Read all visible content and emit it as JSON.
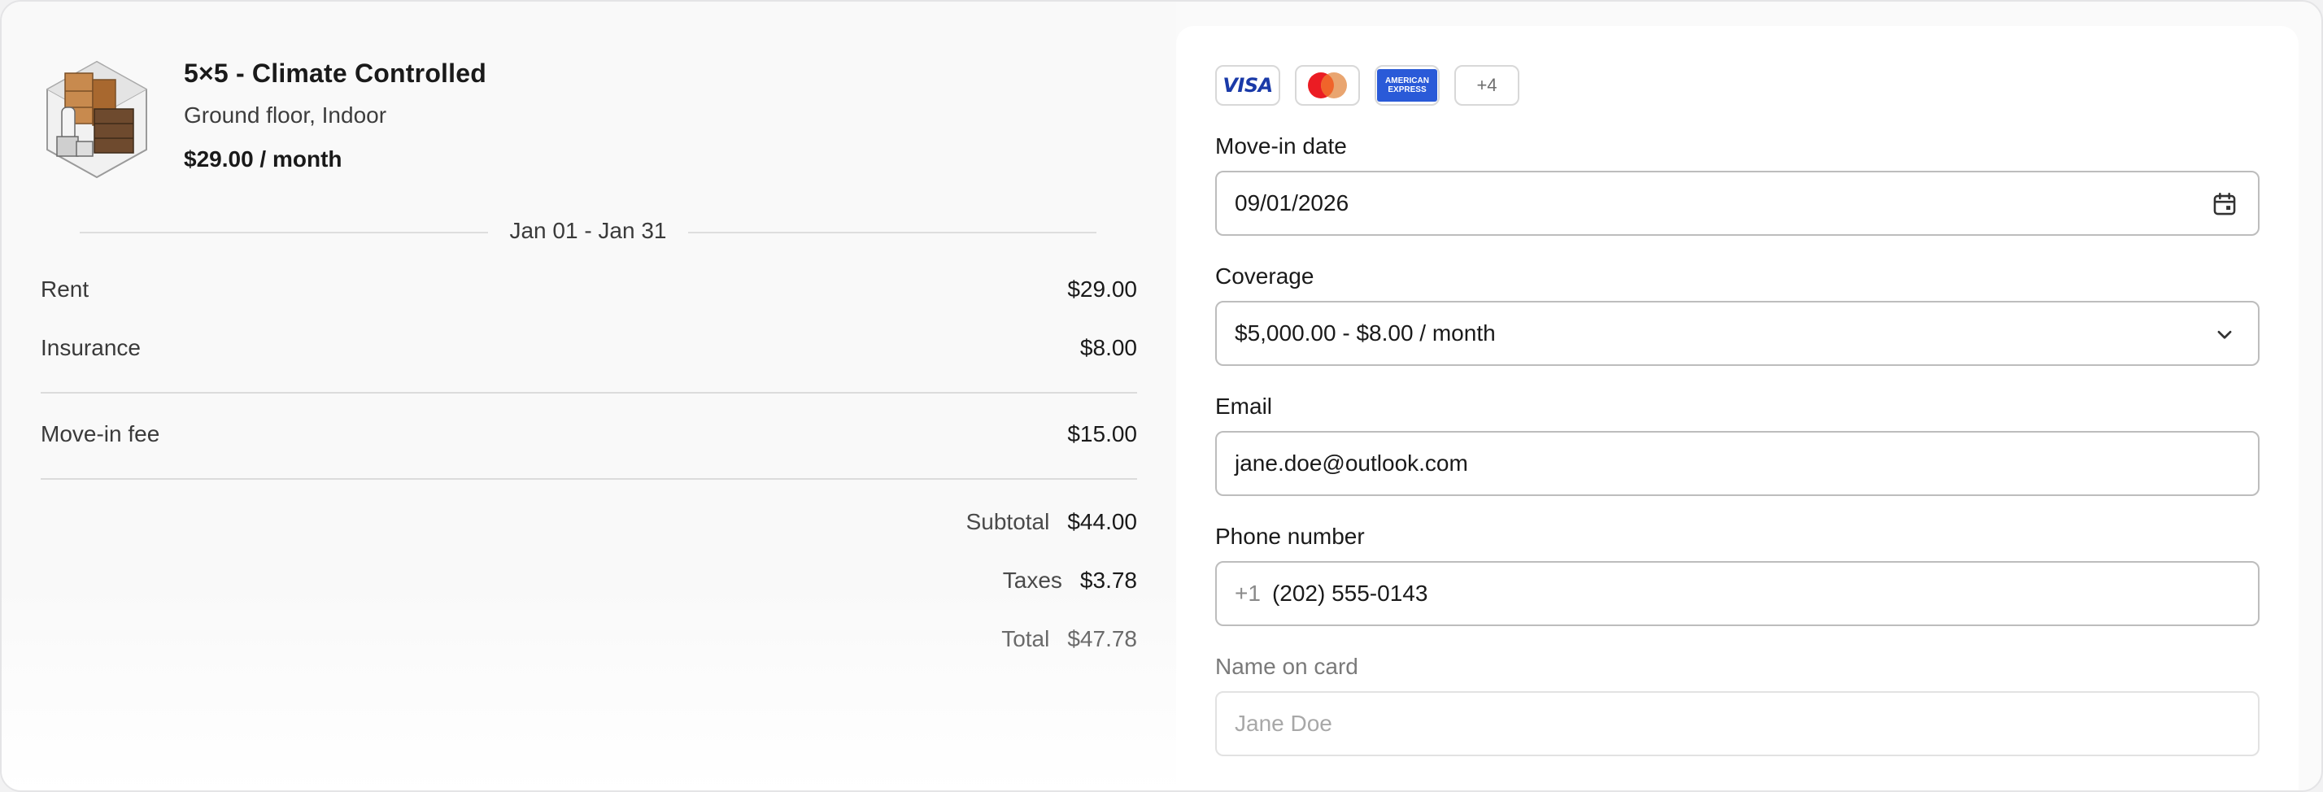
{
  "unit": {
    "title": "5×5 - Climate Controlled",
    "subtitle": "Ground floor, Indoor",
    "price": "$29.00 / month"
  },
  "period": "Jan 01 - Jan 31",
  "lines": [
    {
      "label": "Rent",
      "amount": "$29.00"
    },
    {
      "label": "Insurance",
      "amount": "$8.00"
    },
    {
      "label": "Move-in fee",
      "amount": "$15.00"
    }
  ],
  "summary": {
    "subtotal_label": "Subtotal",
    "subtotal": "$44.00",
    "taxes_label": "Taxes",
    "taxes": "$3.78",
    "total_label": "Total",
    "total": "$47.78"
  },
  "cards": {
    "visa": "VISA",
    "amex_line1": "AMERICAN",
    "amex_line2": "EXPRESS",
    "more": "+4"
  },
  "form": {
    "move_in_label": "Move-in date",
    "move_in_value": "09/01/2026",
    "coverage_label": "Coverage",
    "coverage_value": "$5,000.00 - $8.00 / month",
    "email_label": "Email",
    "email_value": "jane.doe@outlook.com",
    "phone_label": "Phone number",
    "phone_prefix": "+1",
    "phone_value": "(202) 555-0143",
    "name_label": "Name on card",
    "name_placeholder": "Jane Doe"
  },
  "colors": {
    "visa_blue": "#1a3aa8",
    "mastercard_red": "#eb1c23",
    "mastercard_orange": "#e8a068",
    "amex_blue": "#2a5ad8"
  }
}
